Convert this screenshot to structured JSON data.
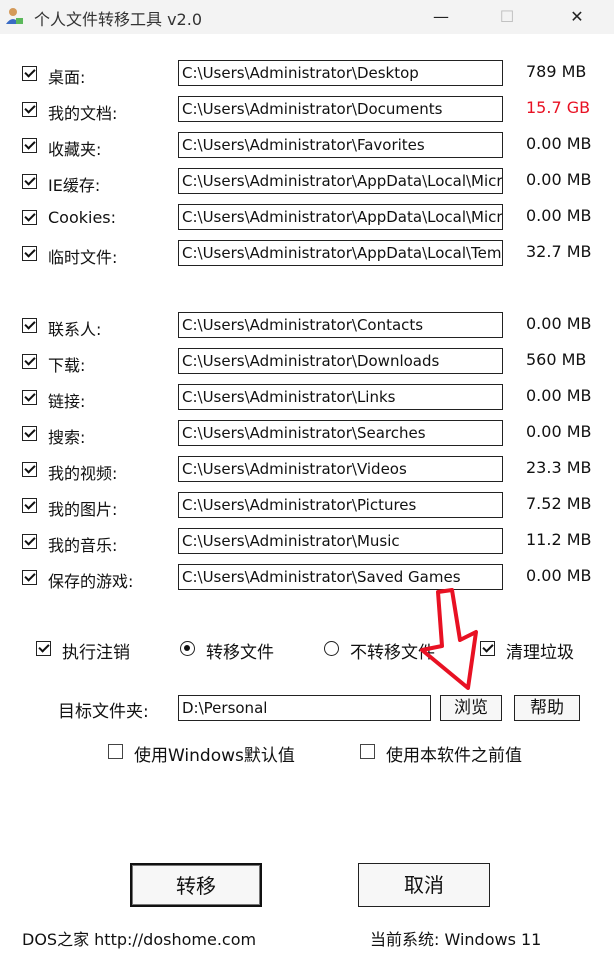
{
  "window": {
    "title": "个人文件转移工具 v2.0",
    "minimize": "—",
    "maximize": "☐",
    "close": "✕"
  },
  "folders": [
    {
      "label": "桌面:",
      "path": "C:\\Users\\Administrator\\Desktop",
      "size": "789  MB",
      "checked": true
    },
    {
      "label": "我的文档:",
      "path": "C:\\Users\\Administrator\\Documents",
      "size": "15.7 GB",
      "checked": true
    },
    {
      "label": "收藏夹:",
      "path": "C:\\Users\\Administrator\\Favorites",
      "size": "0.00 MB",
      "checked": true
    },
    {
      "label": "IE缓存:",
      "path": "C:\\Users\\Administrator\\AppData\\Local\\Micro",
      "size": "0.00 MB",
      "checked": true
    },
    {
      "label": "Cookies:",
      "path": "C:\\Users\\Administrator\\AppData\\Local\\Micro",
      "size": "0.00 MB",
      "checked": true
    },
    {
      "label": "临时文件:",
      "path": "C:\\Users\\Administrator\\AppData\\Local\\Temp",
      "size": "32.7 MB",
      "checked": true
    },
    {
      "label": "联系人:",
      "path": "C:\\Users\\Administrator\\Contacts",
      "size": "0.00 MB",
      "checked": true
    },
    {
      "label": "下载:",
      "path": "C:\\Users\\Administrator\\Downloads",
      "size": "560  MB",
      "checked": true
    },
    {
      "label": "链接:",
      "path": "C:\\Users\\Administrator\\Links",
      "size": "0.00 MB",
      "checked": true
    },
    {
      "label": "搜索:",
      "path": "C:\\Users\\Administrator\\Searches",
      "size": "0.00 MB",
      "checked": true
    },
    {
      "label": "我的视频:",
      "path": "C:\\Users\\Administrator\\Videos",
      "size": "23.3 MB",
      "checked": true
    },
    {
      "label": "我的图片:",
      "path": "C:\\Users\\Administrator\\Pictures",
      "size": "7.52 MB",
      "checked": true
    },
    {
      "label": "我的音乐:",
      "path": "C:\\Users\\Administrator\\Music",
      "size": "11.2 MB",
      "checked": true
    },
    {
      "label": "保存的游戏:",
      "path": "C:\\Users\\Administrator\\Saved Games",
      "size": "0.00 MB",
      "checked": true
    }
  ],
  "options": {
    "logoff": "执行注销",
    "move_files": "转移文件",
    "no_move_files": "不转移文件",
    "clean_junk": "清理垃圾"
  },
  "target": {
    "label": "目标文件夹:",
    "value": "D:\\Personal",
    "browse": "浏览",
    "help": "帮助"
  },
  "defaults": {
    "use_windows_default": "使用Windows默认值",
    "use_previous": "使用本软件之前值"
  },
  "actions": {
    "transfer": "转移",
    "cancel": "取消"
  },
  "footer": {
    "site": "DOS之家 http://doshome.com",
    "system": "当前系统: Windows 11"
  },
  "colors": {
    "size_warning": "#e81123",
    "annotation_arrow": "#e81123"
  }
}
